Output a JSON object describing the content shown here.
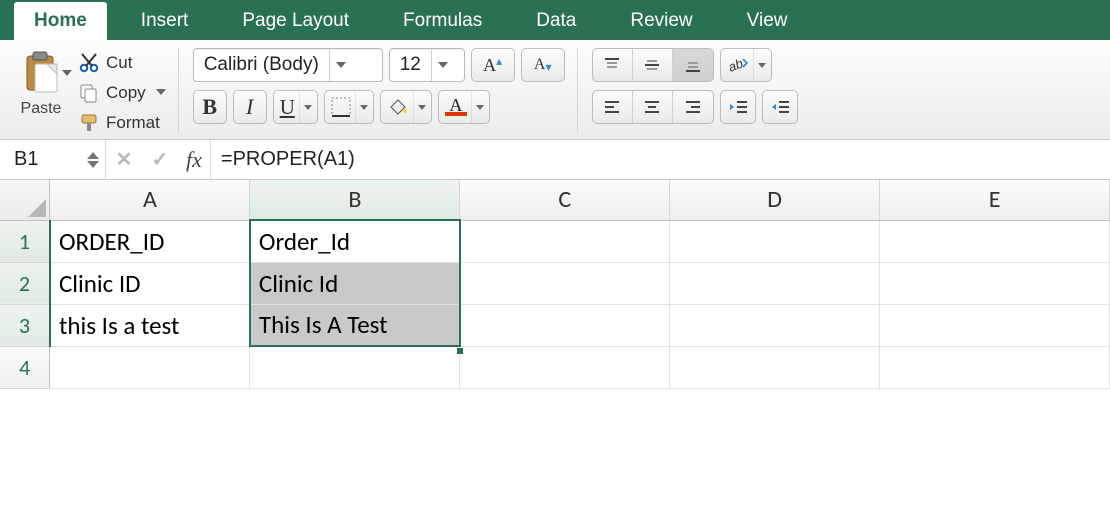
{
  "tabs": {
    "home": "Home",
    "insert": "Insert",
    "page_layout": "Page Layout",
    "formulas": "Formulas",
    "data": "Data",
    "review": "Review",
    "view": "View"
  },
  "clipboard": {
    "paste": "Paste",
    "cut": "Cut",
    "copy": "Copy",
    "format": "Format"
  },
  "font": {
    "name": "Calibri (Body)",
    "size": "12"
  },
  "formula_bar": {
    "cell_ref": "B1",
    "fx": "fx",
    "formula": "=PROPER(A1)"
  },
  "columns": [
    "A",
    "B",
    "C",
    "D",
    "E"
  ],
  "rows": [
    "1",
    "2",
    "3",
    "4"
  ],
  "cells": {
    "A1": "ORDER_ID",
    "B1": "Order_Id",
    "A2": "Clinic ID",
    "B2": "Clinic Id",
    "A3": "this Is a test",
    "B3": "This Is A Test"
  },
  "chart_data": {
    "type": "table",
    "columns": [
      "A",
      "B"
    ],
    "rows": [
      {
        "A": "ORDER_ID",
        "B": "Order_Id"
      },
      {
        "A": "Clinic ID",
        "B": "Clinic Id"
      },
      {
        "A": "this Is a test",
        "B": "This Is A Test"
      }
    ],
    "formula_B": "=PROPER(A{row})"
  },
  "colors": {
    "brand": "#2a7152",
    "font_color": "#d83b01"
  }
}
